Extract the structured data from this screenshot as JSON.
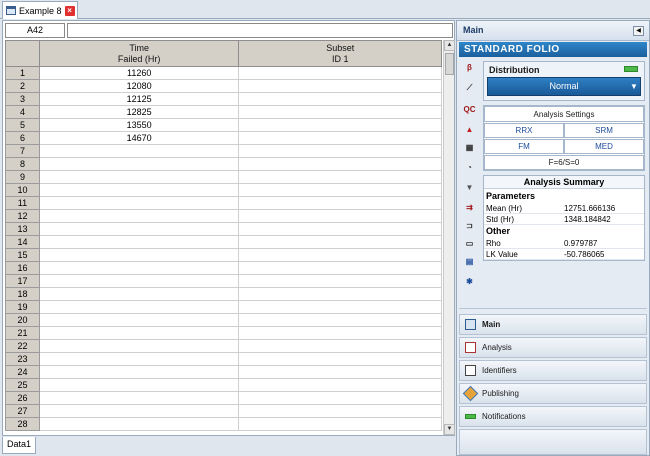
{
  "document_tab": {
    "title": "Example 8"
  },
  "sheet": {
    "cell_ref": "A42",
    "columns": [
      {
        "line1": "Time",
        "line2": "Failed (Hr)"
      },
      {
        "line1": "Subset",
        "line2": "ID 1"
      }
    ],
    "row_numbers": [
      "1",
      "2",
      "3",
      "4",
      "5",
      "6",
      "7",
      "8",
      "9",
      "10",
      "11",
      "12",
      "13",
      "14",
      "15",
      "16",
      "17",
      "18",
      "19",
      "20",
      "21",
      "22",
      "23",
      "24",
      "25",
      "26",
      "27",
      "28"
    ],
    "values": [
      "11260",
      "12080",
      "12125",
      "12825",
      "13550",
      "14670"
    ],
    "bottom_tab": "Data1"
  },
  "panel": {
    "title": "Main",
    "banner": "STANDARD FOLIO",
    "distribution": {
      "label": "Distribution",
      "selected": "Normal"
    },
    "settings": {
      "title": "Analysis Settings",
      "rrx": "RRX",
      "srm": "SRM",
      "fm": "FM",
      "med": "MED",
      "footer": "F=6/S=0"
    },
    "summary": {
      "title": "Analysis Summary",
      "parameters_label": "Parameters",
      "mean_label": "Mean (Hr)",
      "mean_value": "12751.666136",
      "std_label": "Std (Hr)",
      "std_value": "1348.184842",
      "other_label": "Other",
      "rho_label": "Rho",
      "rho_value": "0.979787",
      "lk_label": "LK Value",
      "lk_value": "-50.786065"
    },
    "nav": {
      "main": "Main",
      "analysis": "Analysis",
      "identifiers": "Identifiers",
      "publishing": "Publishing",
      "notifications": "Notifications"
    }
  },
  "colors": {
    "accent": "#1f6fb5",
    "distribution_flag": "#4fb84b",
    "close": "#e03030"
  }
}
